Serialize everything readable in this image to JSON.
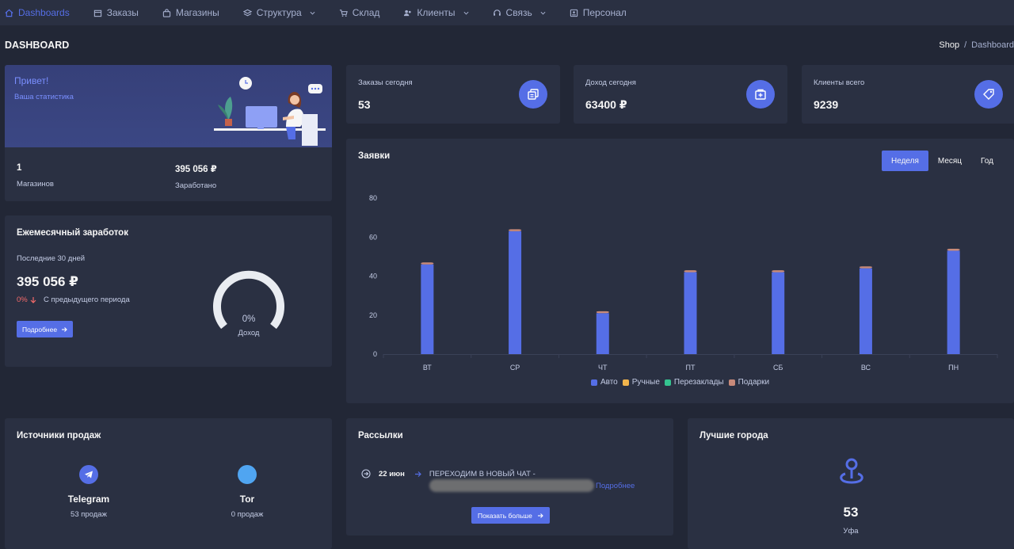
{
  "nav": {
    "items": [
      {
        "label": "Dashboards",
        "icon": "home-icon"
      },
      {
        "label": "Заказы",
        "icon": "calendar-icon"
      },
      {
        "label": "Магазины",
        "icon": "bag-icon"
      },
      {
        "label": "Структура",
        "icon": "layers-icon"
      },
      {
        "label": "Склад",
        "icon": "cart-icon"
      },
      {
        "label": "Клиенты",
        "icon": "users-icon"
      },
      {
        "label": "Связь",
        "icon": "headset-icon"
      },
      {
        "label": "Персонал",
        "icon": "id-card-icon"
      }
    ]
  },
  "page": {
    "title": "DASHBOARD"
  },
  "breadcrumb": {
    "shop": "Shop",
    "separator": "/",
    "current": "Dashboard"
  },
  "welcome": {
    "hello": "Привет!",
    "subtitle": "Ваша статистика",
    "stats": [
      {
        "value": "1",
        "label": "Магазинов"
      },
      {
        "value": "395 056 ₽",
        "label": "Заработано"
      }
    ]
  },
  "stats": [
    {
      "label": "Заказы сегодня",
      "value": "53",
      "icon": "copy-icon"
    },
    {
      "label": "Доход сегодня",
      "value": "63400 ₽",
      "icon": "archive-plus-icon"
    },
    {
      "label": "Клиенты всего",
      "value": "9239",
      "icon": "tag-icon"
    }
  ],
  "monthly": {
    "title": "Ежемесячный заработок",
    "period": "Последние 30 дней",
    "value": "395 056 ₽",
    "change_pct": "0%",
    "change_text": "С предыдущего периода",
    "button": "Подробнее",
    "gauge_value": "0%",
    "gauge_label": "Доход",
    "gauge_fraction": 0
  },
  "orders": {
    "title": "Заявки",
    "tabs": [
      {
        "label": "Неделя",
        "active": true
      },
      {
        "label": "Месяц",
        "active": false
      },
      {
        "label": "Год",
        "active": false
      }
    ]
  },
  "chart_data": {
    "type": "bar",
    "title": "Заявки",
    "stacked": true,
    "categories": [
      "ВТ",
      "СР",
      "ЧТ",
      "ПТ",
      "СБ",
      "ВС",
      "ПН"
    ],
    "series": [
      {
        "name": "Авто",
        "color": "#556ee6",
        "values": [
          46,
          63,
          21,
          42,
          42,
          44,
          53
        ]
      },
      {
        "name": "Ручные",
        "color": "#f1b44c",
        "values": [
          0,
          0,
          0,
          0,
          0,
          0,
          0
        ]
      },
      {
        "name": "Перезаклады",
        "color": "#34c38f",
        "values": [
          0,
          0,
          0,
          0,
          0,
          0,
          0
        ]
      },
      {
        "name": "Подарки",
        "color": "#c88a7a",
        "values": [
          1,
          1,
          1,
          1,
          1,
          1,
          1
        ]
      }
    ],
    "ylim": [
      0,
      80
    ],
    "yticks": [
      0,
      20,
      40,
      60,
      80
    ],
    "grid": false,
    "legend": "bottom"
  },
  "sources": {
    "title": "Источники продаж",
    "items": [
      {
        "name": "Telegram",
        "count": "53 продаж",
        "color": "#556ee6",
        "icon": "telegram-icon"
      },
      {
        "name": "Tor",
        "count": "0 продаж",
        "color": "#50a5f1",
        "icon": "tor-icon"
      }
    ]
  },
  "mailings": {
    "title": "Рассылки",
    "date": "22 июн",
    "text": "ПЕРЕХОДИМ В НОВЫЙ ЧАТ -",
    "more": "Подробнее",
    "button": "Показать больше"
  },
  "cities": {
    "title": "Лучшие города",
    "count": "53",
    "name": "Уфа"
  }
}
